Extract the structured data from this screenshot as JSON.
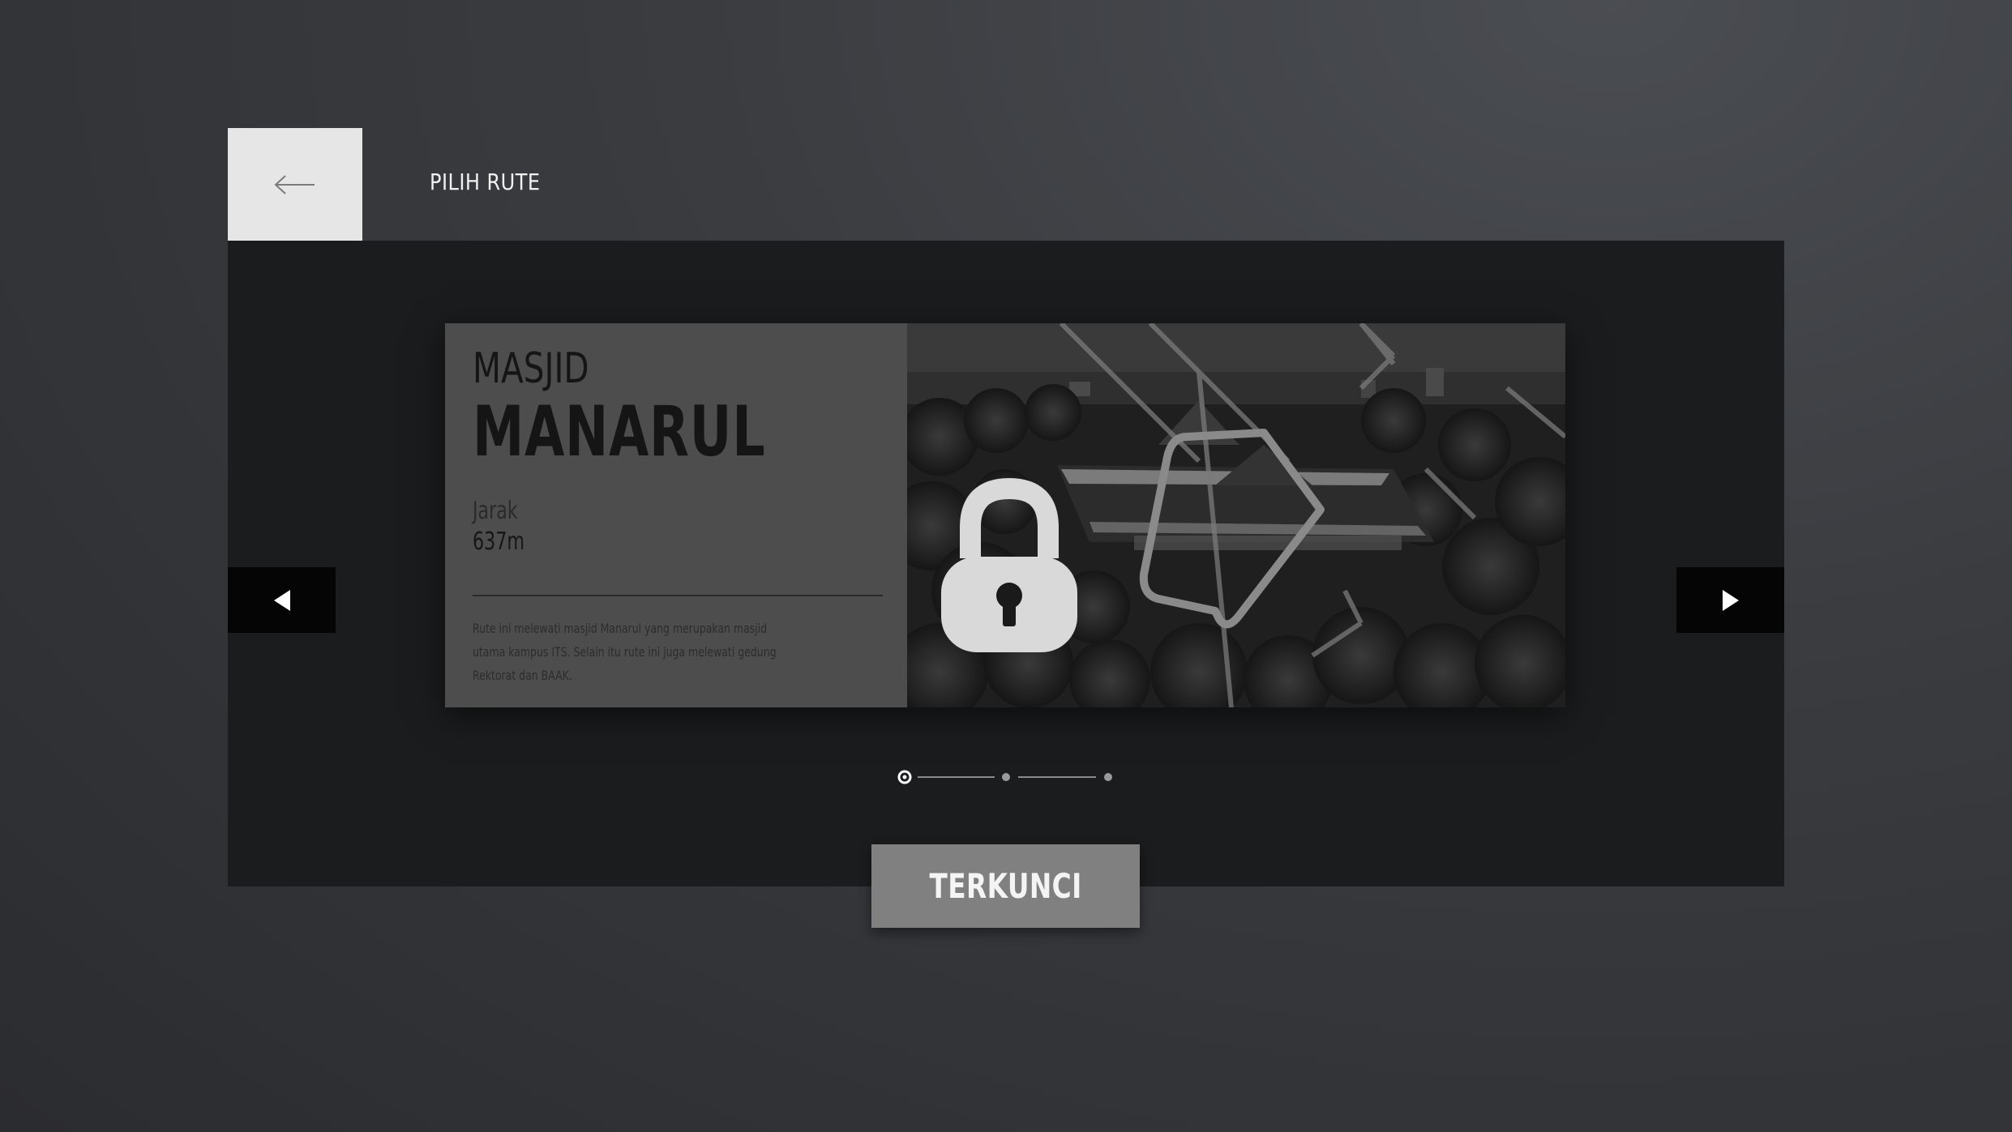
{
  "header": {
    "title": "PILIH RUTE",
    "back_icon": "arrow-left-icon"
  },
  "route": {
    "subtitle": "MASJID",
    "title": "MANARUL",
    "distance_label": "Jarak",
    "distance_value": "637m",
    "description": "Rute ini melewati masjid Manarul yang merupakan masjid utama kampus ITS. Selain itu rute ini juga melewati gedung Rektorat dan BAAK.",
    "locked": true,
    "lock_icon": "padlock-icon"
  },
  "navigation": {
    "prev_icon": "triangle-left-icon",
    "next_icon": "triangle-right-icon"
  },
  "pager": {
    "total": 3,
    "active_index": 0
  },
  "action": {
    "label": "TERKUNCI"
  },
  "colors": {
    "panel_bg": "#1b1c1d",
    "card_info_bg": "#4d4d4d",
    "button_bg": "#808080",
    "back_tile_bg": "#e6e6e6"
  }
}
